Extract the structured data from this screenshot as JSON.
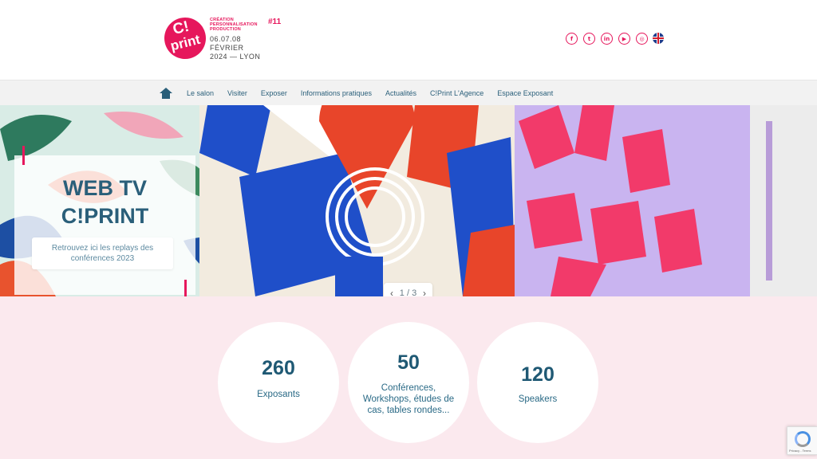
{
  "header": {
    "logo": {
      "line1": "C!",
      "line2": "print",
      "tagline": "CRÉATION PERSONNALISATION PRODUCTION",
      "edition": "#11",
      "dates_line1": "06.07.08",
      "dates_line2": "FÉVRIER",
      "dates_line3": "2024 — LYON"
    },
    "social": [
      "facebook-icon",
      "twitter-icon",
      "linkedin-icon",
      "youtube-icon",
      "instagram-icon",
      "uk-flag-icon"
    ]
  },
  "nav": {
    "items": [
      "Le salon",
      "Visiter",
      "Exposer",
      "Informations pratiques",
      "Actualités",
      "C!Print L'Agence",
      "Espace Exposant"
    ]
  },
  "hero": {
    "title_line1": "WEB TV",
    "title_line2": "C!PRINT",
    "button_label": "Retrouvez ici les replays des conférences 2023",
    "pager_text": "1 / 3"
  },
  "stats": [
    {
      "value": "260",
      "label": "Exposants"
    },
    {
      "value": "50",
      "label": "Conférences, Workshops, études de cas, tables rondes..."
    },
    {
      "value": "120",
      "label": "Speakers"
    }
  ],
  "recaptcha": {
    "text": "Privacy - Terms"
  },
  "colors": {
    "brand": "#e6175c",
    "primary": "#2a5f7a",
    "background": "#fbe9ee"
  }
}
